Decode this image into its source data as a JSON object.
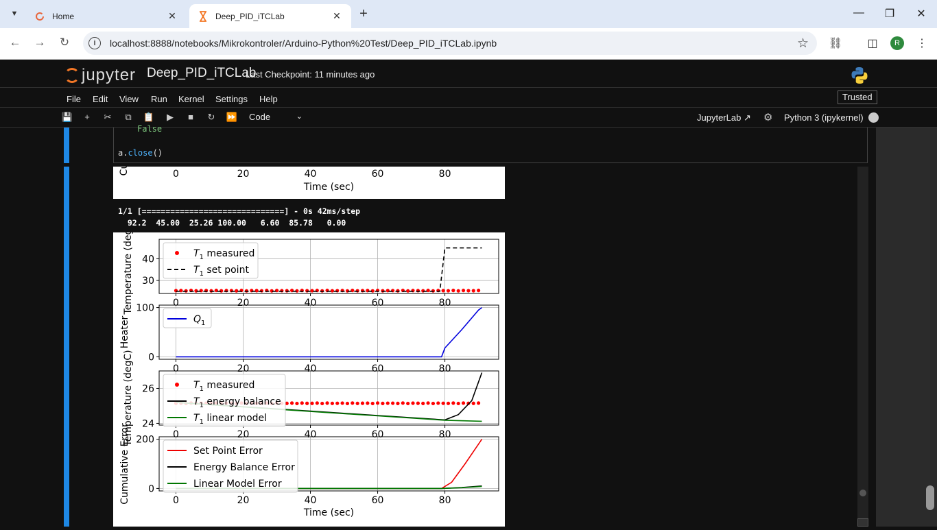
{
  "browser": {
    "tabs": [
      {
        "label": "Home",
        "close": "✕"
      },
      {
        "label": "Deep_PID_iTCLab",
        "close": "✕"
      }
    ],
    "url": "localhost:8888/notebooks/Mikrokontroler/Arduino-Python%20Test/Deep_PID_iTCLab.ipynb",
    "profile_initial": "R",
    "colors": {
      "tabbar": "#dfe8f6",
      "active_tab": "#ffffff",
      "omnibox": "#eef1f6"
    }
  },
  "jupyter": {
    "logo_text": "jupyter",
    "notebook_name": "Deep_PID_iTCLab",
    "checkpoint": "Last Checkpoint: 11 minutes ago",
    "menu": [
      "File",
      "Edit",
      "View",
      "Run",
      "Kernel",
      "Settings",
      "Help"
    ],
    "trusted": "Trusted",
    "cell_type": "Code",
    "jupyterlab_link": "JupyterLab",
    "kernel_name": "Python 3 (ipykernel)",
    "colors": {
      "accent": "#1e88e5",
      "logo": "#f37726",
      "background": "#111111"
    }
  },
  "cell": {
    "code_line_partial": "False",
    "code_line": "a.close()",
    "code_fn": "close",
    "code_obj": "a."
  },
  "output": {
    "stream_line1": "1/1 [==============================] - 0s 42ms/step",
    "stream_line2": "  92.2  45.00  25.26 100.00   6.60  85.78   0.00"
  },
  "chart_data": [
    {
      "type": "line",
      "partial": true,
      "xlabel": "Time (sec)",
      "ylabel": "Cu",
      "xticks": [
        0,
        20,
        40,
        60,
        80
      ],
      "xlim": [
        -5,
        96
      ]
    },
    {
      "type": "scatter",
      "ylabel": "Temperature (degC)",
      "xlim": [
        -5,
        96
      ],
      "ylim": [
        24,
        49
      ],
      "yticks": [
        30,
        40
      ],
      "xticks": [
        0,
        20,
        40,
        60,
        80
      ],
      "grid": true,
      "legend": "top-left",
      "series": [
        {
          "name": "T_1 measured",
          "style": "red-dots",
          "color": "#ff0000",
          "x_start": 0,
          "x_end": 91,
          "x_step": 1.5,
          "y": 25.3
        },
        {
          "name": "T_1 set point",
          "style": "black-dashed",
          "color": "#000000",
          "points": [
            [
              0,
              25
            ],
            [
              78.5,
              25
            ],
            [
              80,
              45
            ],
            [
              91,
              45
            ]
          ]
        }
      ]
    },
    {
      "type": "line",
      "ylabel": "Heater",
      "xlim": [
        -5,
        96
      ],
      "ylim": [
        -5,
        105
      ],
      "yticks": [
        0,
        100
      ],
      "xticks": [
        0,
        20,
        40,
        60,
        80
      ],
      "grid": true,
      "legend": "top-left",
      "series": [
        {
          "name": "Q_1",
          "color": "#0000dd",
          "points": [
            [
              0,
              0
            ],
            [
              79,
              0
            ],
            [
              80,
              18
            ],
            [
              85,
              55
            ],
            [
              90,
              95
            ],
            [
              91,
              100
            ]
          ]
        }
      ]
    },
    {
      "type": "line",
      "ylabel": "Temperature (degC)",
      "xlim": [
        -5,
        96
      ],
      "ylim": [
        23.9,
        27.0
      ],
      "yticks": [
        24,
        26
      ],
      "xticks": [
        0,
        20,
        40,
        60,
        80
      ],
      "grid": true,
      "legend": "top-left",
      "series": [
        {
          "name": "T_1 measured",
          "style": "red-dots",
          "color": "#ff0000",
          "x_start": 0,
          "x_end": 91,
          "x_step": 1.5,
          "y": 25.15
        },
        {
          "name": "T_1 energy balance",
          "color": "#000000",
          "points": [
            [
              0,
              25.2
            ],
            [
              40,
              24.7
            ],
            [
              60,
              24.45
            ],
            [
              80,
              24.2
            ],
            [
              84,
              24.5
            ],
            [
              88,
              25.3
            ],
            [
              91,
              26.9
            ]
          ]
        },
        {
          "name": "T_1 linear model",
          "color": "#007700",
          "points": [
            [
              0,
              25.2
            ],
            [
              40,
              24.68
            ],
            [
              60,
              24.43
            ],
            [
              80,
              24.18
            ],
            [
              91,
              24.12
            ]
          ]
        }
      ]
    },
    {
      "type": "line",
      "ylabel": "Cumulative Error",
      "xlabel": "Time (sec)",
      "xlim": [
        -5,
        96
      ],
      "ylim": [
        -10,
        210
      ],
      "yticks": [
        0,
        200
      ],
      "xticks": [
        0,
        20,
        40,
        60,
        80
      ],
      "grid": true,
      "legend": "top-left",
      "series": [
        {
          "name": "Set Point Error",
          "color": "#ee0000",
          "points": [
            [
              0,
              0
            ],
            [
              79,
              0
            ],
            [
              82,
              25
            ],
            [
              86,
              100
            ],
            [
              91,
              200
            ]
          ]
        },
        {
          "name": "Energy Balance Error",
          "color": "#000000",
          "points": [
            [
              0,
              0
            ],
            [
              79,
              0
            ],
            [
              85,
              4
            ],
            [
              91,
              10
            ]
          ]
        },
        {
          "name": "Linear Model Error",
          "color": "#007700",
          "points": [
            [
              0,
              0
            ],
            [
              79,
              0
            ],
            [
              85,
              3
            ],
            [
              91,
              8
            ]
          ]
        }
      ]
    }
  ]
}
